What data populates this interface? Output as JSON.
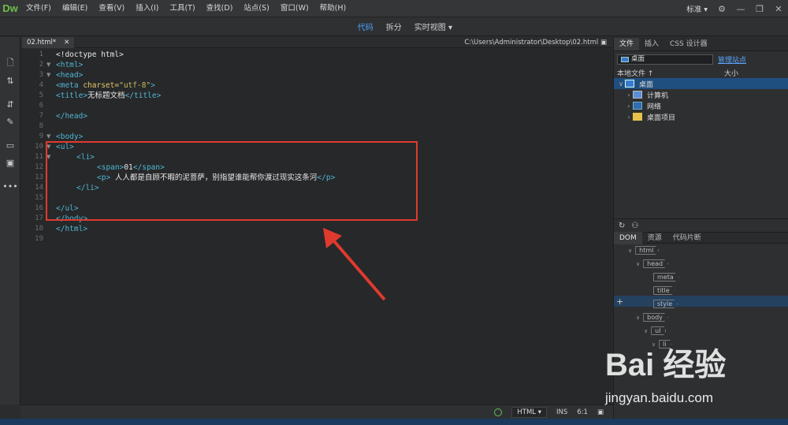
{
  "app": {
    "logo": "Dw"
  },
  "menu": [
    "文件(F)",
    "编辑(E)",
    "查看(V)",
    "插入(I)",
    "工具(T)",
    "查找(D)",
    "站点(S)",
    "窗口(W)",
    "帮助(H)"
  ],
  "workspace": {
    "label": "标准",
    "settings_icon": "gear-icon"
  },
  "views": {
    "code": "代码",
    "split": "拆分",
    "live": "实时视图",
    "active": "code"
  },
  "document": {
    "tab_name": "02.html*",
    "path": "C:\\Users\\Administrator\\Desktop\\02.html"
  },
  "code_lines": [
    {
      "n": "1",
      "fold": ""
    },
    {
      "n": "2",
      "fold": "▼"
    },
    {
      "n": "3",
      "fold": "▼"
    },
    {
      "n": "4",
      "fold": ""
    },
    {
      "n": "5",
      "fold": ""
    },
    {
      "n": "6",
      "fold": ""
    },
    {
      "n": "7",
      "fold": ""
    },
    {
      "n": "8",
      "fold": ""
    },
    {
      "n": "9",
      "fold": "▼"
    },
    {
      "n": "10",
      "fold": "▼"
    },
    {
      "n": "11",
      "fold": "▼"
    },
    {
      "n": "12",
      "fold": ""
    },
    {
      "n": "13",
      "fold": ""
    },
    {
      "n": "14",
      "fold": ""
    },
    {
      "n": "15",
      "fold": ""
    },
    {
      "n": "16",
      "fold": ""
    },
    {
      "n": "17",
      "fold": ""
    },
    {
      "n": "18",
      "fold": ""
    },
    {
      "n": "19",
      "fold": ""
    }
  ],
  "code": {
    "l1": "<!doctype html>",
    "l2": "<html>",
    "l3": "<head>",
    "l4_tag": "<meta ",
    "l4_attr": "charset=",
    "l4_val": "\"utf-8\"",
    "l4_end": ">",
    "l5_open": "<title>",
    "l5_text": "无标题文档",
    "l5_close": "</title>",
    "l7": "</head>",
    "l9": "<body>",
    "l10": "<ul>",
    "l11": "<li>",
    "l12_open": "<span>",
    "l12_text": "01",
    "l12_close": "</span>",
    "l13_open": "<p>",
    "l13_text": " 人人都是自顾不暇的泥菩萨，别指望谁能帮你渡过现实这条河",
    "l13_close": "</p>",
    "l14": "</li>",
    "l16": "</ul>",
    "l17": "</body>",
    "l18": "</html>"
  },
  "status": {
    "language": "HTML",
    "mode": "INS",
    "position": "6:1"
  },
  "files_panel": {
    "tabs": [
      "文件",
      "插入",
      "CSS 设计器"
    ],
    "site": "桌面",
    "manage_link": "管理站点",
    "header_local": "本地文件 ↑",
    "header_size": "大小",
    "items": [
      {
        "label": "桌面",
        "level": 0,
        "expanded": true,
        "icon": "desktop-icon"
      },
      {
        "label": "计算机",
        "level": 1,
        "expanded": false,
        "icon": "computer-icon"
      },
      {
        "label": "网络",
        "level": 1,
        "expanded": false,
        "icon": "network-icon"
      },
      {
        "label": "桌面项目",
        "level": 1,
        "expanded": false,
        "icon": "folder-icon"
      }
    ]
  },
  "dom_panel": {
    "tabs": [
      "DOM",
      "资源",
      "代码片断"
    ],
    "nodes": [
      {
        "tag": "html",
        "depth": 0
      },
      {
        "tag": "head",
        "depth": 1
      },
      {
        "tag": "meta",
        "depth": 2
      },
      {
        "tag": "title",
        "depth": 2
      },
      {
        "tag": "style",
        "depth": 2
      },
      {
        "tag": "body",
        "depth": 1
      },
      {
        "tag": "ul",
        "depth": 2
      },
      {
        "tag": "li",
        "depth": 3
      }
    ]
  },
  "watermark": {
    "logo": "Bai 经验",
    "url": "jingyan.baidu.com"
  },
  "colors": {
    "highlight_box": "#e03a2f",
    "accent": "#4aa3ff",
    "tag": "#4fb6d6"
  }
}
